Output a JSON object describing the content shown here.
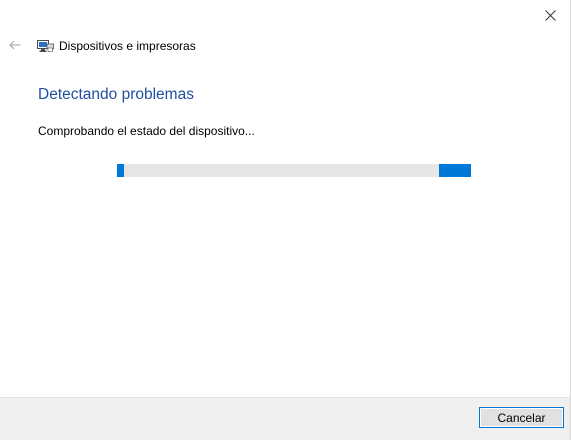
{
  "window": {
    "title": "Dispositivos e impresoras",
    "close_icon": "close-icon",
    "back_icon": "back-arrow-icon",
    "app_icon": "devices-printers-icon"
  },
  "main": {
    "heading": "Detectando problemas",
    "status": "Comprobando el estado del dispositivo...",
    "progress": {
      "state": "indeterminate",
      "accent_color": "#0078d7",
      "track_color": "#e6e6e6"
    }
  },
  "footer": {
    "cancel_label": "Cancelar"
  },
  "colors": {
    "heading": "#1f4f9e",
    "accent": "#0078d7",
    "footer_bg": "#f0f0f0"
  }
}
